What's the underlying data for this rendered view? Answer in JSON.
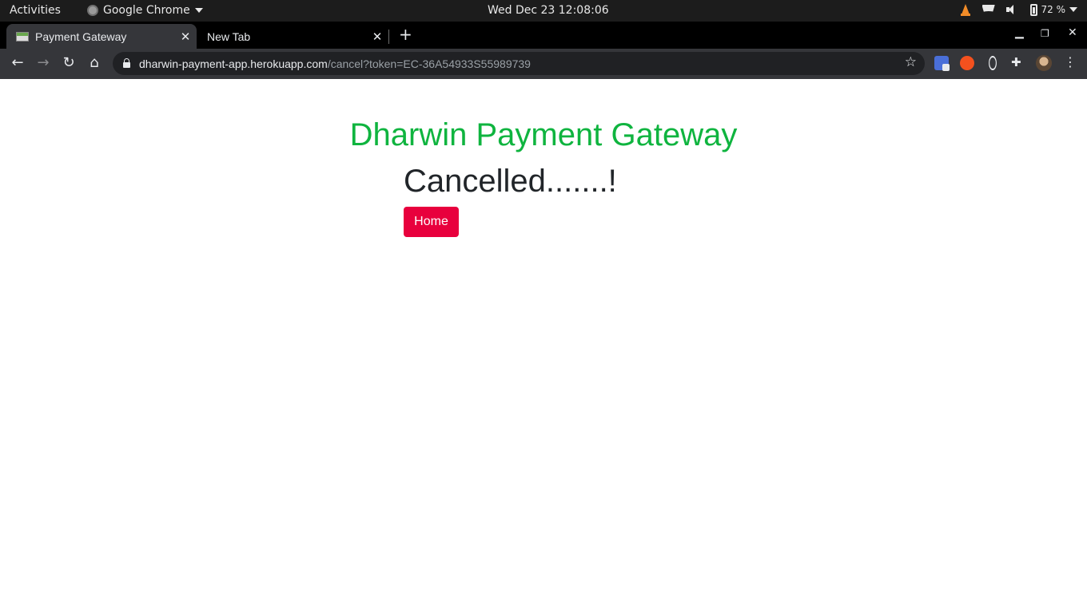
{
  "system_bar": {
    "activities": "Activities",
    "app_name": "Google Chrome",
    "clock": "Wed Dec 23  12:08:06",
    "battery": "72 %"
  },
  "tabs": [
    {
      "title": "Payment Gateway",
      "active": true
    },
    {
      "title": "New Tab",
      "active": false
    }
  ],
  "address_bar": {
    "host": "dharwin-payment-app.herokuapp.com",
    "path": "/cancel?token=EC-36A54933S55989739"
  },
  "page": {
    "heading": "Dharwin Payment Gateway",
    "status": "Cancelled.......!",
    "home_button": "Home"
  },
  "colors": {
    "heading": "#0fb43f",
    "status_text": "#212529",
    "button": "#e8003d",
    "toolbar": "#35363a"
  },
  "icons": [
    "chrome-icon",
    "vlc-icon",
    "wifi-icon",
    "volume-icon",
    "battery-icon",
    "back-icon",
    "forward-icon",
    "reload-icon",
    "home-icon",
    "lock-icon",
    "star-icon",
    "translate-extension-icon",
    "extension-icon",
    "react-devtools-icon",
    "puzzle-icon",
    "profile-avatar",
    "kebab-menu-icon"
  ]
}
